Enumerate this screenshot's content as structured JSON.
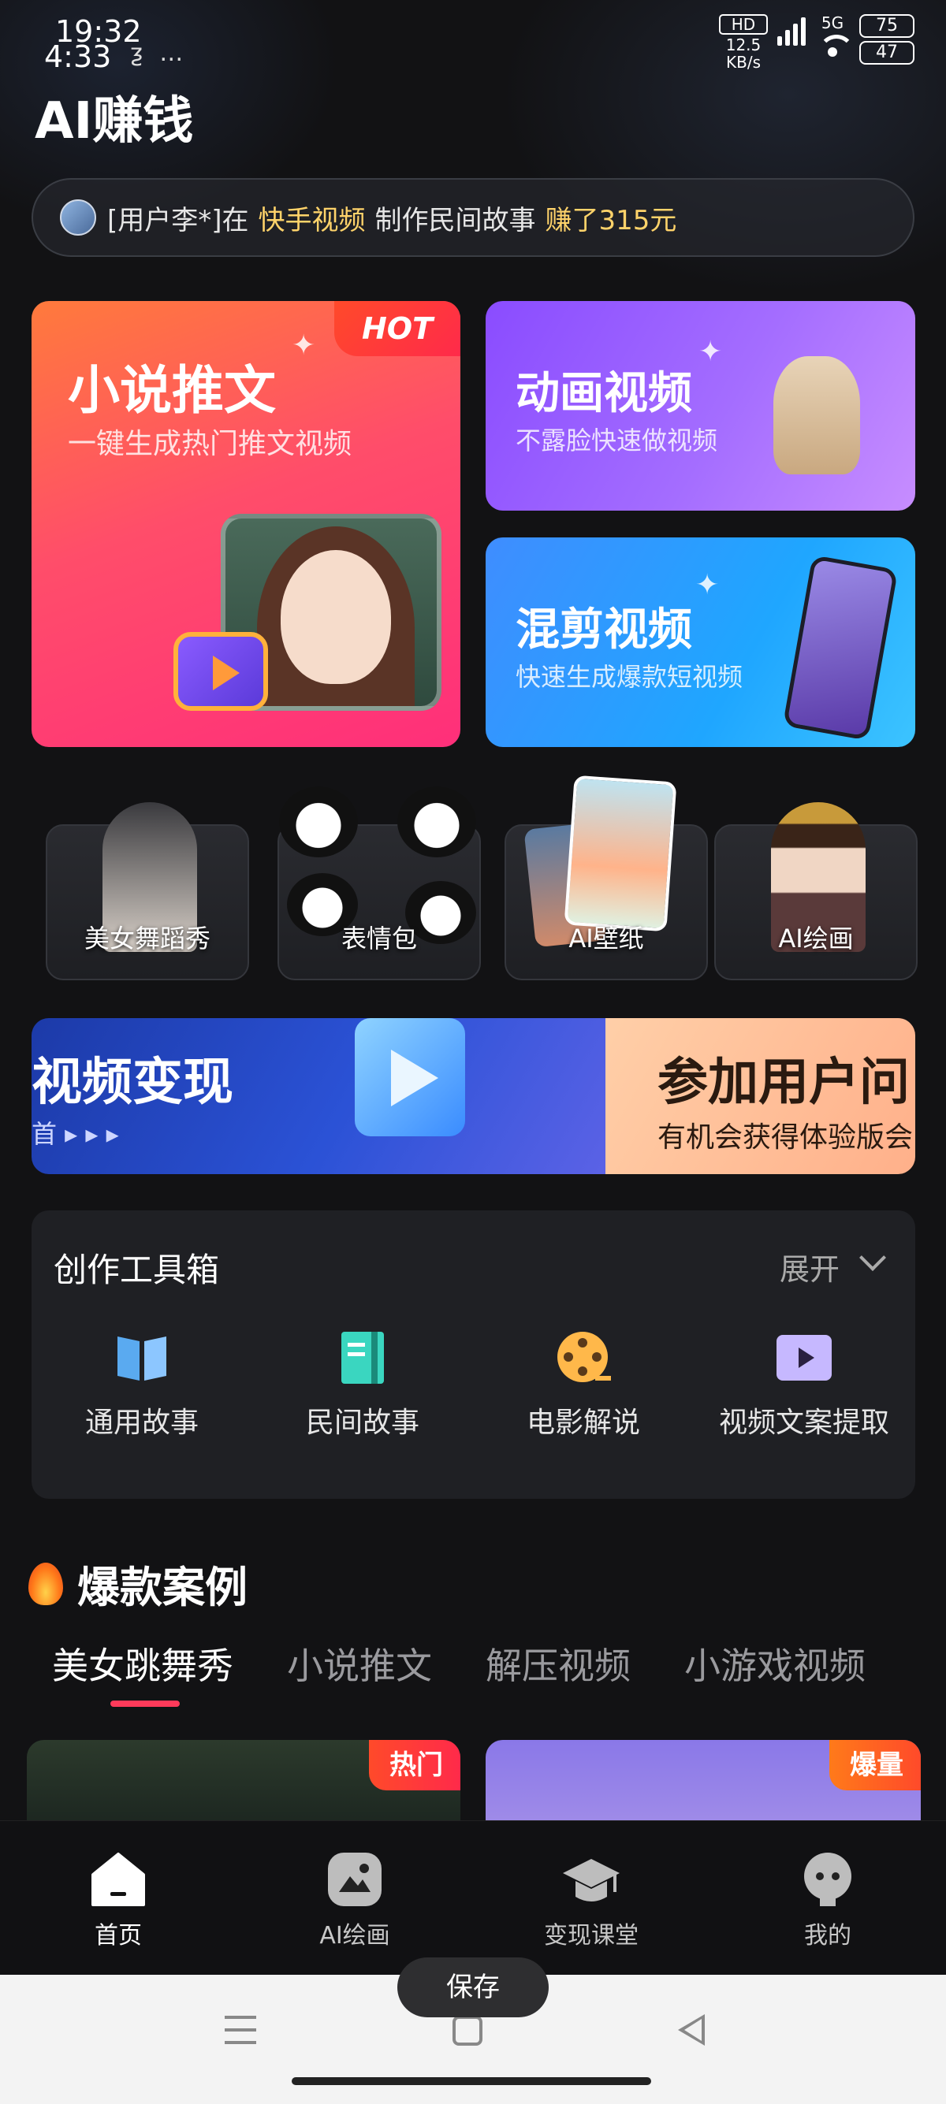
{
  "status_bar": {
    "time_primary": "19:32",
    "time_secondary": "4:33",
    "left_icons": "ƺ …",
    "net_speed": "12.5 KB/s",
    "hd_label": "HD",
    "network_label": "5G",
    "battery_primary": "75",
    "battery_secondary": "47"
  },
  "header": {
    "title": "AI赚钱"
  },
  "ticker": {
    "prefix": "[用户李*]在",
    "platform": "快手视频",
    "action": "制作民间故事",
    "earned": "赚了315元"
  },
  "features": {
    "novel": {
      "title": "小说推文",
      "subtitle": "一键生成热门推文视频",
      "badge": "HOT"
    },
    "animation": {
      "title": "动画视频",
      "subtitle": "不露脸快速做视频"
    },
    "remix": {
      "title": "混剪视频",
      "subtitle": "快速生成爆款短视频"
    }
  },
  "tiles": [
    {
      "label": "美女舞蹈秀"
    },
    {
      "label": "表情包"
    },
    {
      "label": "AI壁纸"
    },
    {
      "label": "AI绘画"
    }
  ],
  "banner": {
    "left_title": "视频变现",
    "left_sub": "首 ▸ ▸ ▸",
    "right_title": "参加用户问",
    "right_sub": "有机会获得体验版会"
  },
  "toolbox": {
    "title": "创作工具箱",
    "expand_label": "展开",
    "tools": [
      {
        "name": "通用故事",
        "icon": "book-icon",
        "color": "#5aaaf0"
      },
      {
        "name": "民间故事",
        "icon": "notebook-icon",
        "color": "#3ad6c0"
      },
      {
        "name": "电影解说",
        "icon": "film-reel-icon",
        "color": "#ffb84a"
      },
      {
        "name": "视频文案提取",
        "icon": "video-play-icon",
        "color": "#c6b8ff"
      }
    ]
  },
  "cases": {
    "title": "爆款案例",
    "tabs": [
      "美女跳舞秀",
      "小说推文",
      "解压视频",
      "小游戏视频"
    ],
    "active_tab": 0,
    "card1_badge": "热门",
    "card2_badge": "爆量"
  },
  "nav": {
    "items": [
      {
        "label": "首页",
        "icon": "home-icon"
      },
      {
        "label": "AI绘画",
        "icon": "image-icon"
      },
      {
        "label": "变现课堂",
        "icon": "graduation-cap-icon"
      },
      {
        "label": "我的",
        "icon": "profile-icon"
      }
    ],
    "active": 0
  },
  "system": {
    "toast": "保存"
  },
  "colors": {
    "accent_yellow": "#ffd36a",
    "tab_underline": "#ff3a5a",
    "background": "#121214"
  }
}
